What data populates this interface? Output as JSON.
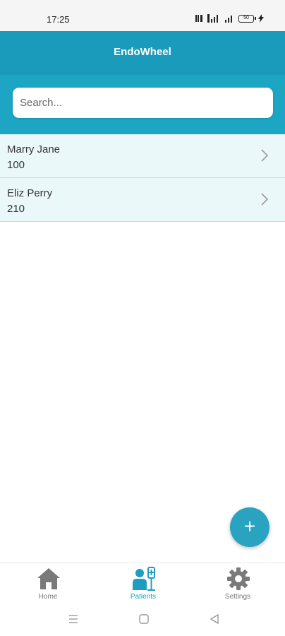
{
  "status_bar": {
    "time": "17:25",
    "battery": "50"
  },
  "header": {
    "title": "EndoWheel"
  },
  "search": {
    "placeholder": "Search..."
  },
  "patients": [
    {
      "name": "Marry Jane",
      "id": "100"
    },
    {
      "name": "Eliz Perry",
      "id": "210"
    }
  ],
  "fab": {
    "label": "+"
  },
  "tabs": [
    {
      "label": "Home",
      "icon": "home-icon"
    },
    {
      "label": "Patients",
      "icon": "patients-icon",
      "active": true
    },
    {
      "label": "Settings",
      "icon": "gear-icon"
    }
  ],
  "colors": {
    "header": "#1b9bbb",
    "search_band": "#1da6c4",
    "list_row": "#eaf8fa",
    "fab": "#2aa3c0",
    "active_tab": "#1f9dc0",
    "inactive_tab": "#777777"
  }
}
